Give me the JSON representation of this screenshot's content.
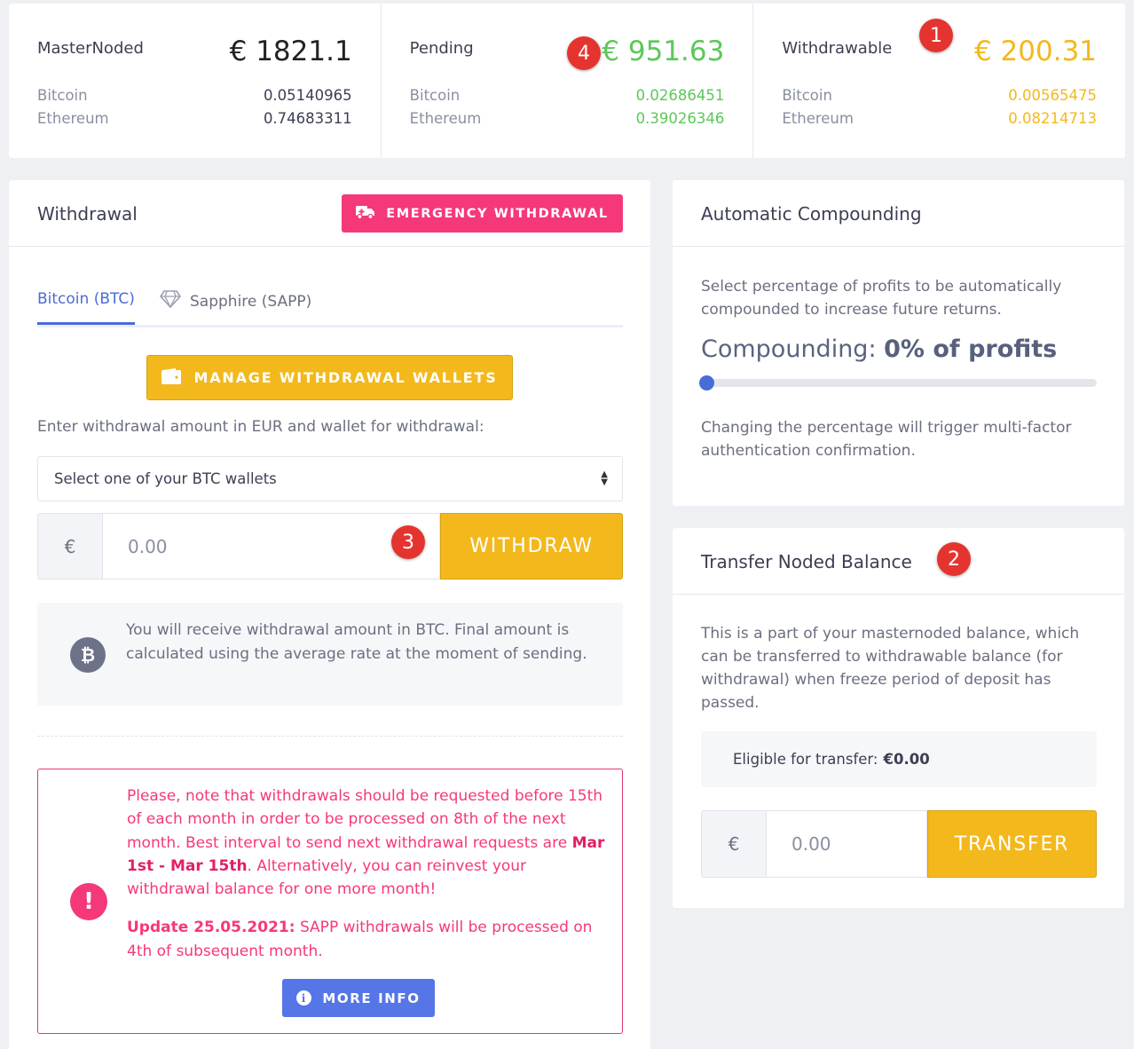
{
  "stats": [
    {
      "title": "MasterNoded",
      "total": "€ 1821.1",
      "rows": [
        {
          "label": "Bitcoin",
          "value": "0.05140965"
        },
        {
          "label": "Ethereum",
          "value": "0.74683311"
        }
      ]
    },
    {
      "title": "Pending",
      "total": "€ 951.63",
      "rows": [
        {
          "label": "Bitcoin",
          "value": "0.02686451"
        },
        {
          "label": "Ethereum",
          "value": "0.39026346"
        }
      ]
    },
    {
      "title": "Withdrawable",
      "total": "€ 200.31",
      "rows": [
        {
          "label": "Bitcoin",
          "value": "0.00565475"
        },
        {
          "label": "Ethereum",
          "value": "0.08214713"
        }
      ]
    }
  ],
  "badges": {
    "one": "1",
    "two": "2",
    "three": "3",
    "four": "4"
  },
  "withdrawal": {
    "title": "Withdrawal",
    "emergency_label": "EMERGENCY WITHDRAWAL",
    "tabs": [
      {
        "label": "Bitcoin (BTC)"
      },
      {
        "label": "Sapphire (SAPP)"
      }
    ],
    "manage_label": "MANAGE WITHDRAWAL WALLETS",
    "enter_text": "Enter withdrawal amount in EUR and wallet for withdrawal:",
    "wallet_select": "Select one of your BTC wallets",
    "currency": "€",
    "amount_placeholder": "0.00",
    "withdraw_label": "WITHDRAW",
    "info_text": "You will receive withdrawal amount in BTC. Final amount is calculated using the average rate at the moment of sending.",
    "alert": {
      "text_pre": "Please, note that withdrawals should be requested before 15th of each month in order to be processed on 8th of the next month. Best interval to send next withdrawal requests are ",
      "interval": "Mar 1st - Mar 15th",
      "text_post": ". Alternatively, you can reinvest your withdrawal balance for one more month!",
      "update_label": "Update 25.05.2021:",
      "update_text": " SAPP withdrawals will be processed on 4th of subsequent month.",
      "more_label": "MORE INFO"
    }
  },
  "compounding": {
    "title": "Automatic Compounding",
    "description": "Select percentage of profits to be automatically compounded to increase future returns.",
    "label": "Compounding: ",
    "value": "0% of profits",
    "level_percent": 0,
    "note": "Changing the percentage will trigger multi-factor authentication confirmation."
  },
  "transfer": {
    "title": "Transfer Noded Balance",
    "description": "This is a part of your masternoded balance, which can be transferred to withdrawable balance (for withdrawal) when freeze period of deposit has passed.",
    "eligible_label": "Eligible for transfer:",
    "eligible_value": "€0.00",
    "currency": "€",
    "amount_placeholder": "0.00",
    "transfer_label": "TRANSFER"
  },
  "colors": {
    "green": "#5cc85a",
    "yellow": "#f3b81c",
    "pink": "#f5387a",
    "blue": "#4a6cd6",
    "badge_red": "#e5342f"
  }
}
